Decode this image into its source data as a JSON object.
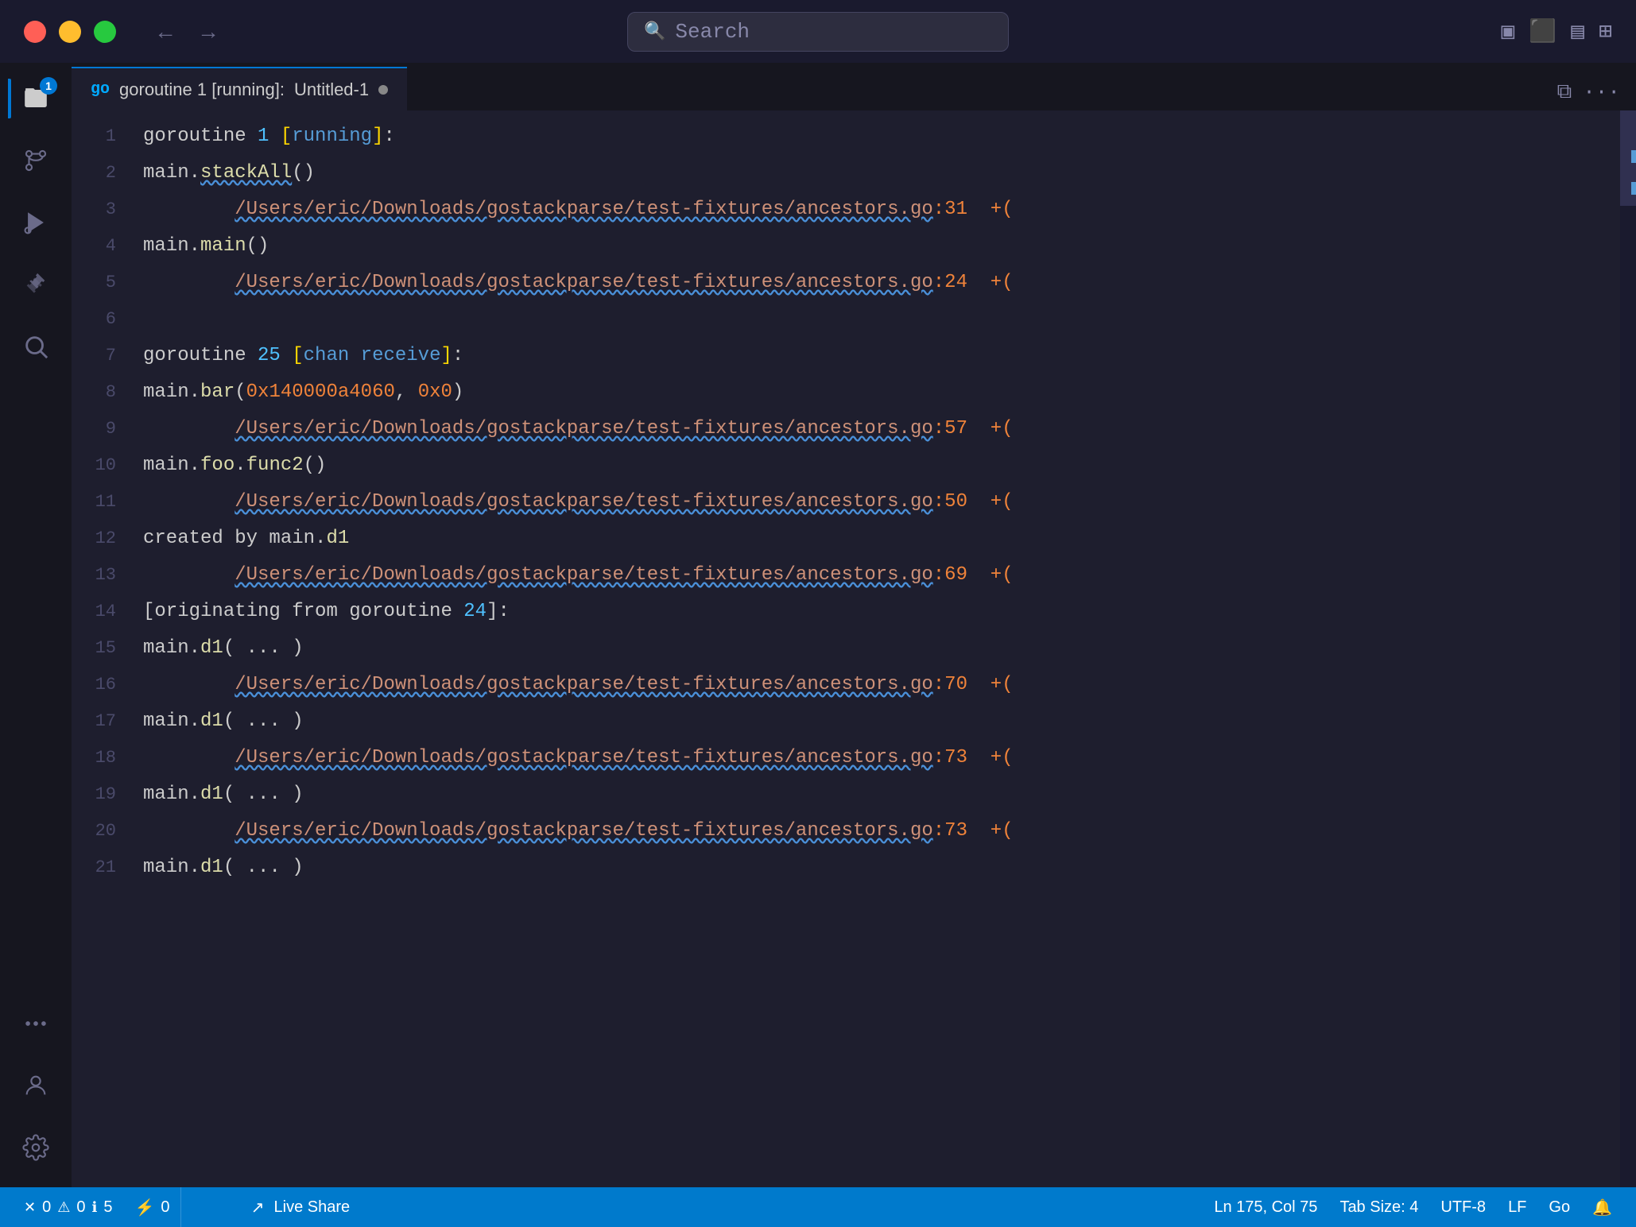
{
  "titlebar": {
    "search_placeholder": "Search",
    "nav_back": "←",
    "nav_forward": "→"
  },
  "tab": {
    "go_label": "go",
    "title": "goroutine 1 [running]:",
    "filename": "Untitled-1"
  },
  "code": {
    "lines": [
      {
        "num": 1,
        "text": "goroutine 1 [running]:"
      },
      {
        "num": 2,
        "text": "main.stackAll()"
      },
      {
        "num": 3,
        "text": "\t/Users/eric/Downloads/gostackparse/test-fixtures/ancestors.go:31\t+("
      },
      {
        "num": 4,
        "text": "main.main()"
      },
      {
        "num": 5,
        "text": "\t/Users/eric/Downloads/gostackparse/test-fixtures/ancestors.go:24\t+("
      },
      {
        "num": 6,
        "text": ""
      },
      {
        "num": 7,
        "text": "goroutine 25 [chan receive]:"
      },
      {
        "num": 8,
        "text": "main.bar(0x140000a4060, 0x0)"
      },
      {
        "num": 9,
        "text": "\t/Users/eric/Downloads/gostackparse/test-fixtures/ancestors.go:57\t+("
      },
      {
        "num": 10,
        "text": "main.foo.func2()"
      },
      {
        "num": 11,
        "text": "\t/Users/eric/Downloads/gostackparse/test-fixtures/ancestors.go:50\t+("
      },
      {
        "num": 12,
        "text": "created by main.d1"
      },
      {
        "num": 13,
        "text": "\t/Users/eric/Downloads/gostackparse/test-fixtures/ancestors.go:69\t+("
      },
      {
        "num": 14,
        "text": "[originating from goroutine 24]:"
      },
      {
        "num": 15,
        "text": "main.d1( ... )"
      },
      {
        "num": 16,
        "text": "\t/Users/eric/Downloads/gostackparse/test-fixtures/ancestors.go:70\t+("
      },
      {
        "num": 17,
        "text": "main.d1( ... )"
      },
      {
        "num": 18,
        "text": "\t/Users/eric/Downloads/gostackparse/test-fixtures/ancestors.go:73\t+("
      },
      {
        "num": 19,
        "text": "main.d1( ... )"
      },
      {
        "num": 20,
        "text": "\t/Users/eric/Downloads/gostackparse/test-fixtures/ancestors.go:73\t+("
      },
      {
        "num": 21,
        "text": "main.d1( ... )"
      }
    ]
  },
  "statusbar": {
    "errors": "0",
    "warnings": "0",
    "info": "5",
    "port": "0",
    "live_share": "Live Share",
    "cursor": "Ln 175, Col 75",
    "tab_size": "Tab Size: 4",
    "encoding": "UTF-8",
    "line_ending": "LF",
    "language": "Go",
    "bell": "🔔"
  },
  "colors": {
    "accent": "#0078d4",
    "statusbar_bg": "#007acc",
    "editor_bg": "#1e1e2e",
    "sidebar_bg": "#16161f"
  }
}
